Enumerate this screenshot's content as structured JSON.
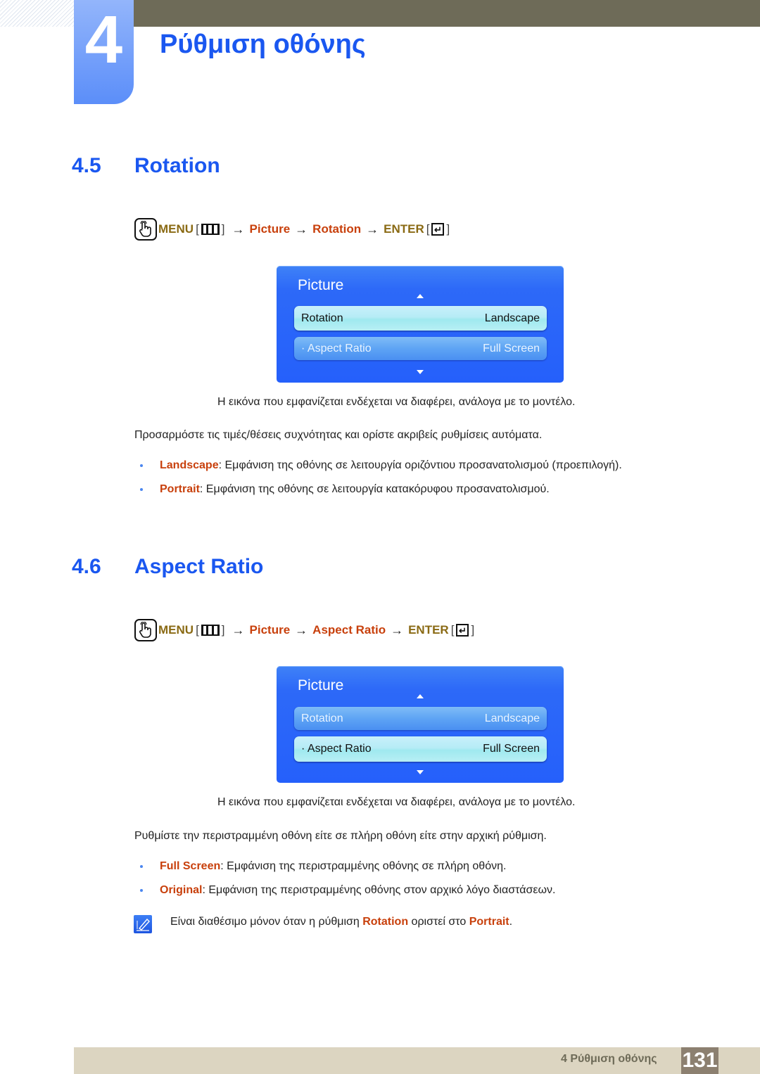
{
  "header": {
    "chapter_number": "4",
    "chapter_title": "Ρύθμιση οθόνης"
  },
  "sections": [
    {
      "number": "4.5",
      "title": "Rotation",
      "menu_path": {
        "menu_label": "MENU",
        "steps": [
          "Picture",
          "Rotation"
        ],
        "enter_label": "ENTER",
        "arrow": "→",
        "open_bracket": "[",
        "close_bracket": "]"
      },
      "osd": {
        "title": "Picture",
        "rows": [
          {
            "label": "Rotation",
            "value": "Landscape",
            "selected": true
          },
          {
            "label": "· Aspect Ratio",
            "value": "Full Screen",
            "selected": false
          }
        ]
      },
      "caption": "Η εικόνα που εμφανίζεται ενδέχεται να διαφέρει, ανάλογα με το μοντέλο.",
      "description": "Προσαρμόστε τις τιμές/θέσεις συχνότητας και ορίστε ακριβείς ρυθμίσεις αυτόματα.",
      "bullets": [
        {
          "term": "Landscape",
          "text": ": Εμφάνιση της οθόνης σε λειτουργία οριζόντιου προσανατολισμού (προεπιλογή)."
        },
        {
          "term": "Portrait",
          "text": ": Εμφάνιση της οθόνης σε λειτουργία κατακόρυφου προσανατολισμού."
        }
      ]
    },
    {
      "number": "4.6",
      "title": "Aspect Ratio",
      "menu_path": {
        "menu_label": "MENU",
        "steps": [
          "Picture",
          "Aspect Ratio"
        ],
        "enter_label": "ENTER",
        "arrow": "→",
        "open_bracket": "[",
        "close_bracket": "]"
      },
      "osd": {
        "title": "Picture",
        "rows": [
          {
            "label": "Rotation",
            "value": "Landscape",
            "selected": false
          },
          {
            "label": "·  Aspect Ratio",
            "value": "Full Screen",
            "selected": true
          }
        ]
      },
      "caption": "Η εικόνα που εμφανίζεται ενδέχεται να διαφέρει, ανάλογα με το μοντέλο.",
      "description": "Ρυθμίστε την περιστραμμένη οθόνη είτε σε πλήρη οθόνη είτε στην αρχική ρύθμιση.",
      "bullets": [
        {
          "term": "Full Screen",
          "text": ": Εμφάνιση της περιστραμμένης οθόνης σε πλήρη οθόνη."
        },
        {
          "term": "Original",
          "text": ": Εμφάνιση της περιστραμμένης οθόνης στον αρχικό λόγο διαστάσεων."
        }
      ],
      "note": {
        "prefix": "Είναι διαθέσιμο μόνον όταν η ρύθμιση ",
        "term1": "Rotation",
        "middle": " οριστεί στο ",
        "term2": "Portrait",
        "suffix": "."
      }
    }
  ],
  "footer": {
    "label": "4 Ρύθμιση οθόνης",
    "page_number": "131"
  },
  "colors": {
    "heading_blue": "#1a57f0",
    "term_red": "#c8400c",
    "menu_gold": "#8a6a14",
    "topbar": "#6e6b58",
    "footer_bg": "#dcd5c1",
    "page_badge": "#8c8070"
  }
}
